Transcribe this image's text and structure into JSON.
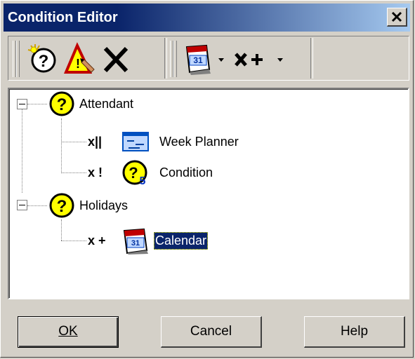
{
  "window": {
    "title": "Condition Editor",
    "close_label": "×"
  },
  "toolbar": {
    "buttons": [
      {
        "icon": "new-condition-icon"
      },
      {
        "icon": "edit-condition-icon"
      },
      {
        "icon": "delete-icon"
      },
      {
        "icon": "calendar-icon"
      },
      {
        "icon": "operator-icon",
        "label": "x+"
      }
    ],
    "dropdown_arrow": "▾"
  },
  "tree": {
    "groups": [
      {
        "label": "Attendant",
        "children": [
          {
            "prefix": "x||",
            "label": "Week Planner",
            "icon": "week-planner-icon"
          },
          {
            "prefix": "x !",
            "label": "Condition",
            "icon": "condition-icon"
          }
        ]
      },
      {
        "label": "Holidays",
        "children": [
          {
            "prefix": "x +",
            "label": "Calendar",
            "icon": "calendar-icon",
            "selected": true
          }
        ]
      }
    ]
  },
  "buttons": {
    "ok": {
      "label": "OK",
      "accel": "O"
    },
    "cancel": {
      "label": "Cancel",
      "accel": "C"
    },
    "help": {
      "label": "Help",
      "accel": "H"
    }
  },
  "colors": {
    "title_bar_start": "#0a246a",
    "title_bar_end": "#a6caf0",
    "selection": "#0a246a",
    "question_yellow": "#ffff00"
  }
}
